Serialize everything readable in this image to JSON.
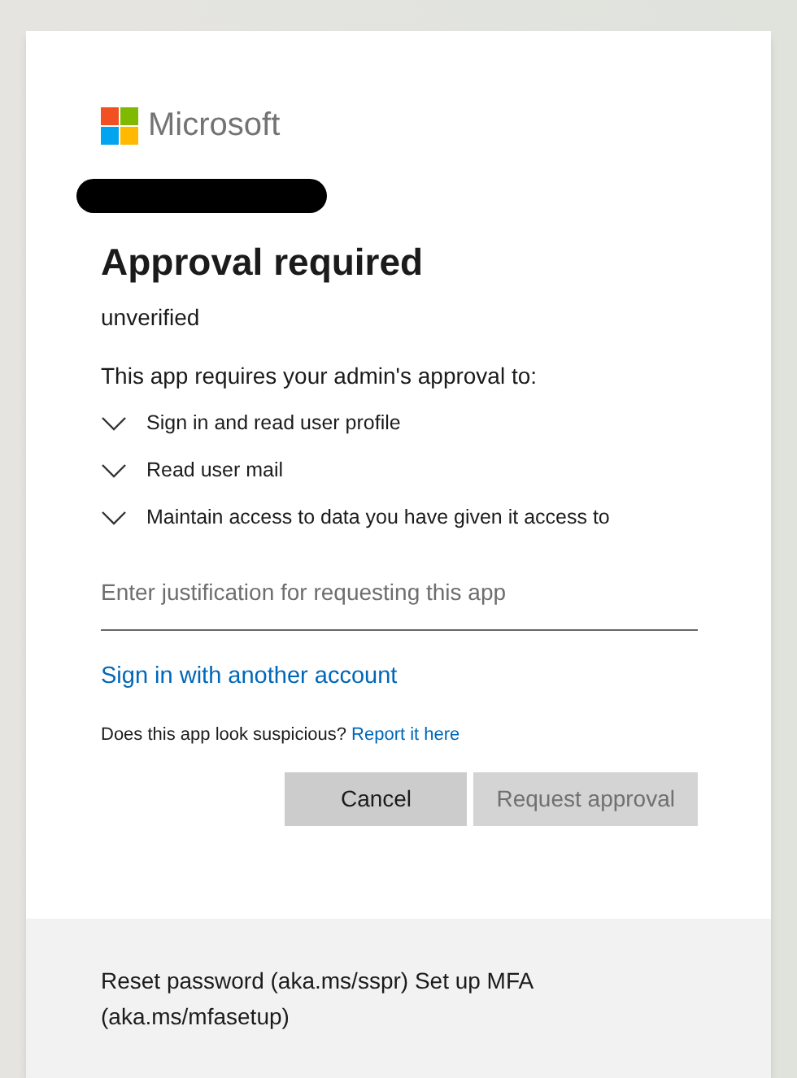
{
  "brand": {
    "name": "Microsoft"
  },
  "title": "Approval required",
  "app_status": "unverified",
  "intro": "This app requires your admin's approval to:",
  "permissions": [
    {
      "label": "Sign in and read user profile",
      "expanded": false
    },
    {
      "label": "Read user mail",
      "expanded": false
    },
    {
      "label": "Maintain access to data you have given it access to",
      "expanded": false
    }
  ],
  "justification": {
    "placeholder": "Enter justification for requesting this app"
  },
  "other_account_link": "Sign in with another account",
  "report": {
    "question": "Does this app look suspicious?",
    "link": "Report it here"
  },
  "buttons": [
    {
      "label": "Cancel",
      "disabled": false
    },
    {
      "label": "Request approval",
      "disabled": true
    }
  ],
  "footer": "Reset password (aka.ms/sspr) Set up MFA (aka.ms/mfasetup)"
}
